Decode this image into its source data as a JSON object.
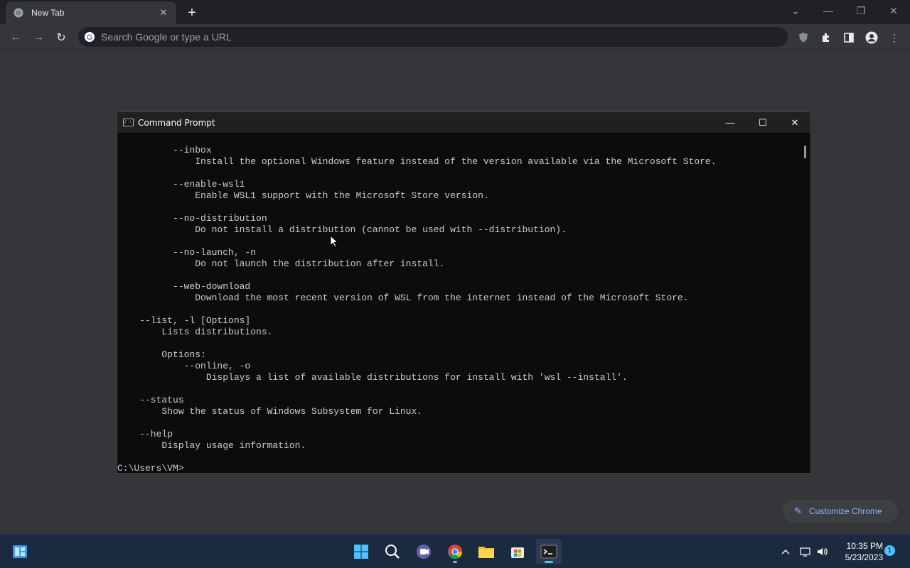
{
  "browser": {
    "tab_title": "New Tab",
    "omnibox_placeholder": "Search Google or type a URL",
    "customize_label": "Customize Chrome"
  },
  "cmd": {
    "window_title": "Command Prompt",
    "lines": [
      "          --inbox",
      "              Install the optional Windows feature instead of the version available via the Microsoft Store.",
      "",
      "          --enable-wsl1",
      "              Enable WSL1 support with the Microsoft Store version.",
      "",
      "          --no-distribution",
      "              Do not install a distribution (cannot be used with --distribution).",
      "",
      "          --no-launch, -n",
      "              Do not launch the distribution after install.",
      "",
      "          --web-download",
      "              Download the most recent version of WSL from the internet instead of the Microsoft Store.",
      "",
      "    --list, -l [Options]",
      "        Lists distributions.",
      "",
      "        Options:",
      "            --online, -o",
      "                Displays a list of available distributions for install with 'wsl --install'.",
      "",
      "    --status",
      "        Show the status of Windows Subsystem for Linux.",
      "",
      "    --help",
      "        Display usage information.",
      "",
      "C:\\Users\\VM>"
    ]
  },
  "taskbar": {
    "time": "10:35 PM",
    "date": "5/23/2023",
    "notification_count": "1"
  }
}
